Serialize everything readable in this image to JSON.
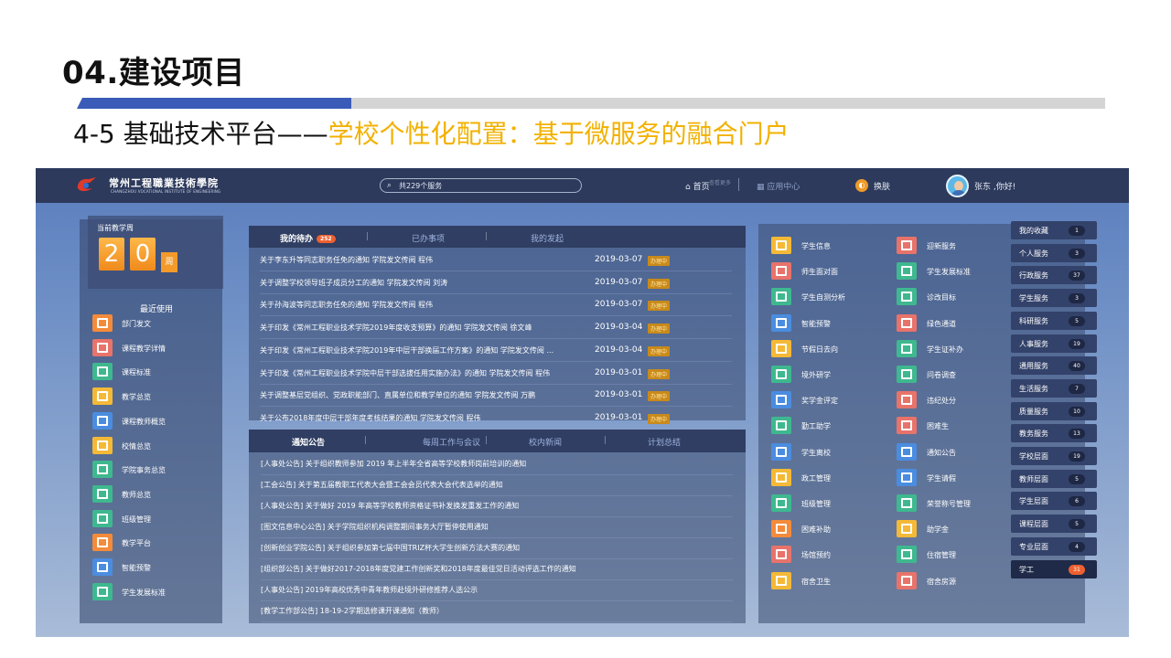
{
  "slide": {
    "title": "04.建设项目",
    "subtitle_prefix": "4-5 基础技术平台——",
    "subtitle_highlight": "学校个性化配置：基于微服务的融合门户"
  },
  "colors": {
    "accent_blue": "#3a5bb8",
    "highlight": "#f2b100",
    "badge": "#ee6030",
    "topbar": "#2d3a5c"
  },
  "topbar": {
    "logo_text": "常州工程職業技術學院",
    "logo_sub": "CHANGZHOU VOCATIONAL INSTITUTE OF ENGINEERING",
    "search_placeholder": "共229个服务",
    "home": "首页",
    "app_center": "应用中心",
    "skin": "换肤",
    "greeting": "张东 ,你好!"
  },
  "week": {
    "label": "当前教学周",
    "d1": "2",
    "d2": "0",
    "unit": "周"
  },
  "recent": {
    "title": "最近使用",
    "items": [
      "部门发文",
      "课程教学详情",
      "课程标准",
      "教学总览",
      "课程教师概览",
      "校情总览",
      "学院事务总览",
      "教师总览",
      "班级管理",
      "教学平台",
      "智能预警",
      "学生发展标准"
    ]
  },
  "todo": {
    "tabs": [
      "我的待办",
      "已办事项",
      "我的发起"
    ],
    "badge": "252",
    "more": "查看更多",
    "rows": [
      {
        "title": "关于李东升等同志职务任免的通知 学院发文传阅 程伟",
        "date": "2019-03-07",
        "status": "办理中"
      },
      {
        "title": "关于调整学校领导班子成员分工的通知 学院发文传阅 刘涛",
        "date": "2019-03-07",
        "status": "办理中"
      },
      {
        "title": "关于孙海波等同志职务任免的通知 学院发文传阅 程伟",
        "date": "2019-03-07",
        "status": "办理中"
      },
      {
        "title": "关于印发《常州工程职业技术学院2019年度收支预算》的通知 学院发文传阅 徐文峰",
        "date": "2019-03-04",
        "status": "办理中"
      },
      {
        "title": "关于印发《常州工程职业技术学院2019年中层干部换届工作方案》的通知 学院发文传阅 ...",
        "date": "2019-03-04",
        "status": "办理中"
      },
      {
        "title": "关于印发《常州工程职业技术学院中层干部选拔任用实施办法》的通知 学院发文传阅 程伟",
        "date": "2019-03-01",
        "status": "办理中"
      },
      {
        "title": "关于调整基层党组织、党政职能部门、直属单位和教学单位的通知 学院发文传阅 万鹏",
        "date": "2019-03-01",
        "status": "办理中"
      },
      {
        "title": "关于公布2018年度中层干部年度考核结果的通知 学院发文传阅 程伟",
        "date": "2019-03-01",
        "status": "办理中"
      }
    ]
  },
  "news": {
    "tabs": [
      "通知公告",
      "每周工作与会议",
      "校内新闻",
      "计划总结"
    ],
    "rows": [
      "[人事处公告] 关于组织教师参加 2019 年上半年全省高等学校教师岗前培训的通知",
      "[工会公告] 关于第五届教职工代表大会暨工会会员代表大会代表选举的通知",
      "[人事处公告] 关于做好 2019 年高等学校教师资格证书补发换发重发工作的通知",
      "[图文信息中心公告] 关于学院组织机构调整期间事务大厅暂停使用通知",
      "[创新创业学院公告] 关于组织参加第七届中国TRIZ杯大学生创新方法大赛的通知",
      "[组织部公告] 关于做好2017-2018年度党建工作创新奖和2018年度最佳党日活动评选工作的通知",
      "[人事处公告] 2019年高校优秀中青年教师赴境外研修推荐人选公示",
      "[教学工作部公告] 18-19-2学期选修课开课通知（教师）"
    ]
  },
  "services": {
    "left": [
      "学生信息",
      "师生面对面",
      "学生自测分析",
      "智能预警",
      "节假日去向",
      "境外研学",
      "奖学金评定",
      "勤工助学",
      "学生离校",
      "政工管理",
      "班级管理",
      "困难补助",
      "场馆预约",
      "宿舍卫生"
    ],
    "right": [
      "迎新服务",
      "学生发展标准",
      "诊改目标",
      "绿色通道",
      "学生证补办",
      "问卷调查",
      "违纪处分",
      "困难生",
      "通知公告",
      "学生请假",
      "荣誉称号管理",
      "助学金",
      "住宿管理",
      "宿舍房源"
    ],
    "left_colors": [
      "#f4b937",
      "#e8736a",
      "#3fb88f",
      "#4a8de0",
      "#f4b937",
      "#3fb88f",
      "#4a8de0",
      "#3fb88f",
      "#4a8de0",
      "#f4b937",
      "#3fb88f",
      "#f48b3a",
      "#e8736a",
      "#f4b937"
    ],
    "right_colors": [
      "#e8736a",
      "#3fb88f",
      "#3fb88f",
      "#e8736a",
      "#3fb88f",
      "#3fb88f",
      "#e8736a",
      "#e8736a",
      "#4a8de0",
      "#4a8de0",
      "#3fb88f",
      "#f4b937",
      "#3fb88f",
      "#e8736a"
    ]
  },
  "categories": [
    {
      "label": "我的收藏",
      "num": "1"
    },
    {
      "label": "个人服务",
      "num": "3"
    },
    {
      "label": "行政服务",
      "num": "37"
    },
    {
      "label": "学生服务",
      "num": "3"
    },
    {
      "label": "科研服务",
      "num": "5"
    },
    {
      "label": "人事服务",
      "num": "19"
    },
    {
      "label": "通用服务",
      "num": "40"
    },
    {
      "label": "生活服务",
      "num": "7"
    },
    {
      "label": "质量服务",
      "num": "10"
    },
    {
      "label": "教务服务",
      "num": "13"
    },
    {
      "label": "学校层面",
      "num": "19"
    },
    {
      "label": "教师层面",
      "num": "5"
    },
    {
      "label": "学生层面",
      "num": "6"
    },
    {
      "label": "课程层面",
      "num": "5"
    },
    {
      "label": "专业层面",
      "num": "4"
    },
    {
      "label": "学工",
      "num": "31"
    }
  ],
  "recent_colors": [
    "#f48b3a",
    "#e8736a",
    "#3fb88f",
    "#f4b937",
    "#4a8de0",
    "#f4b937",
    "#3fb88f",
    "#3fb88f",
    "#3fb88f",
    "#f48b3a",
    "#4a8de0",
    "#3fb88f"
  ]
}
